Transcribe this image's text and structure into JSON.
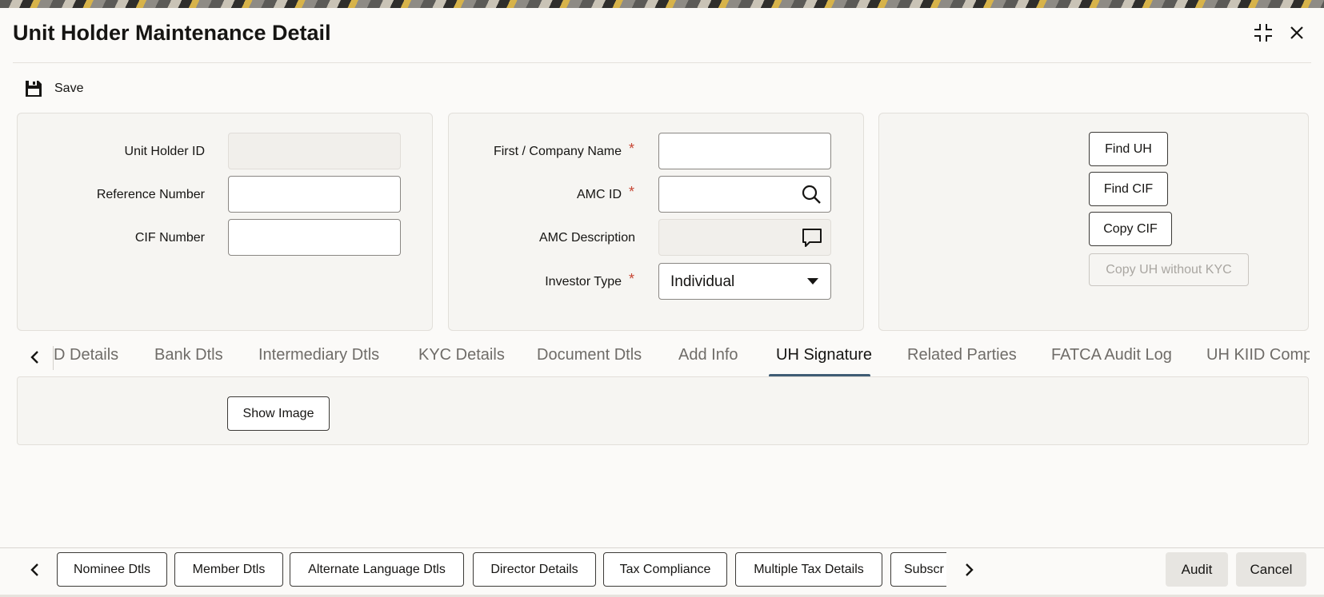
{
  "header": {
    "title": "Unit Holder Maintenance Detail",
    "maximize_icon": "collapse-icon",
    "close_icon": "close-icon"
  },
  "toolbar": {
    "save_label": "Save",
    "save_icon": "floppy-disk-icon"
  },
  "left_panel": {
    "unit_holder_id_label": "Unit Holder ID",
    "unit_holder_id_value": "",
    "reference_number_label": "Reference Number",
    "reference_number_value": "",
    "cif_number_label": "CIF Number",
    "cif_number_value": ""
  },
  "middle_panel": {
    "first_company_name_label": "First / Company Name",
    "first_company_name_value": "",
    "amc_id_label": "AMC ID",
    "amc_id_value": "",
    "amc_description_label": "AMC Description",
    "amc_description_value": "",
    "investor_type_label": "Investor Type",
    "investor_type_value": "Individual",
    "required_mark": "*"
  },
  "right_panel": {
    "find_uh": "Find UH",
    "find_cif": "Find CIF",
    "copy_cif": "Copy CIF",
    "copy_uh_without_kyc": "Copy UH without KYC"
  },
  "tabs": [
    {
      "label": "D Details"
    },
    {
      "label": "Bank Dtls"
    },
    {
      "label": "Intermediary Dtls"
    },
    {
      "label": "KYC Details"
    },
    {
      "label": "Document Dtls"
    },
    {
      "label": "Add Info"
    },
    {
      "label": "UH Signature",
      "active": true
    },
    {
      "label": "Related Parties"
    },
    {
      "label": "FATCA Audit Log"
    },
    {
      "label": "UH KIID Compl"
    }
  ],
  "content": {
    "show_image": "Show Image"
  },
  "bottom_tabs": [
    {
      "label": "Nominee Dtls"
    },
    {
      "label": "Member Dtls"
    },
    {
      "label": "Alternate Language Dtls"
    },
    {
      "label": "Director Details"
    },
    {
      "label": "Tax Compliance"
    },
    {
      "label": "Multiple Tax Details"
    },
    {
      "label": "Subscr"
    }
  ],
  "actions": {
    "audit": "Audit",
    "cancel": "Cancel"
  },
  "colors": {
    "required": "#c74634",
    "active_tab_underline": "#3f5c74"
  }
}
